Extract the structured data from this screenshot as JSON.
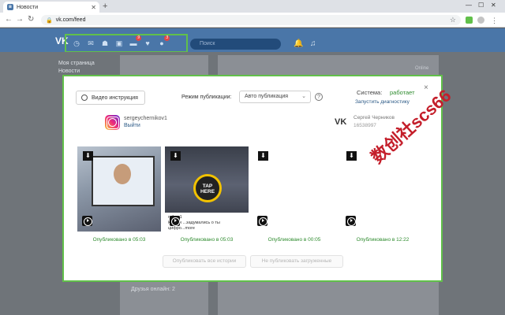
{
  "browser": {
    "tab_title": "Новости",
    "tab_favicon": "vk-favicon",
    "new_tab": "+",
    "url": "vk.com/feed",
    "window_controls": [
      "—",
      "☐",
      "✕"
    ]
  },
  "vk": {
    "logo": "VK",
    "search_placeholder": "Поиск",
    "badges": [
      "9",
      "3"
    ],
    "left_menu": [
      "Моя страница",
      "Новости"
    ],
    "online_label": "Online",
    "friends_online": "Друзья онлайн: 2"
  },
  "modal": {
    "video_button": "Видео инструкция",
    "publish_mode_label": "Режим публикации:",
    "publish_mode_value": "Авто публикация",
    "help": "?",
    "system_label": "Система:",
    "system_status": "работает",
    "diagnostics_link": "Запустить диагностику",
    "close": "×",
    "instagram": {
      "username": "sergeychernikov1",
      "logout": "Выйти"
    },
    "vk_account": {
      "name": "Сергей Черников",
      "id": "16538997"
    },
    "posts": [
      {
        "status": "Опубликовано в 05:03"
      },
      {
        "status": "Опубликовано в 05:03",
        "tap_label_line1": "TAP",
        "tap_label_line2": "HERE",
        "caption_user": "rnikov1",
        "caption_text": "Кстати ...задумались о ты цифро...more"
      },
      {
        "status": "Опубликовано в 00:05"
      },
      {
        "status": "Опубликовано в 12:22"
      }
    ],
    "buttons": {
      "publish_all_stories": "Опубликовать все истории",
      "dont_publish_loaded": "Не публиковать загруженные"
    }
  },
  "watermark": "数创社scs66",
  "colors": {
    "vk_blue": "#4a76a8",
    "highlight_green": "#61c04a",
    "status_green": "#2e8b2e",
    "link_blue": "#2a5885"
  }
}
